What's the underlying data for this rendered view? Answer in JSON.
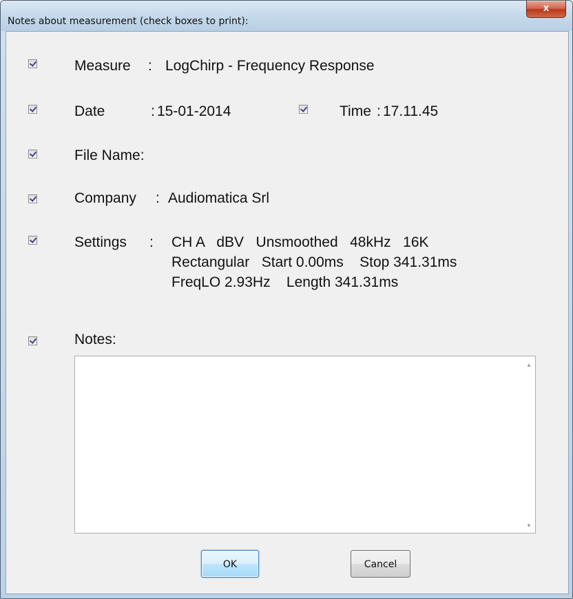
{
  "window": {
    "title": "Notes about measurement (check boxes to print):",
    "close_label": "x"
  },
  "fields": {
    "measure": {
      "label": "Measure",
      "sep": ":",
      "value": "LogChirp - Frequency Response",
      "checked": true
    },
    "date": {
      "label": "Date",
      "sep": ":",
      "value": "15-01-2014",
      "checked": true
    },
    "time": {
      "label": "Time",
      "sep": ":",
      "value": "17.11.45",
      "checked": true
    },
    "file_name": {
      "label": "File Name:",
      "value": "",
      "checked": true
    },
    "company": {
      "label": "Company",
      "sep": ":",
      "value": "Audiomatica Srl",
      "checked": true
    },
    "settings": {
      "label": "Settings",
      "sep": ":",
      "line1": "CH A   dBV   Unsmoothed   48kHz   16K",
      "line2": "Rectangular   Start 0.00ms    Stop 341.31ms",
      "line3": "FreqLO 2.93Hz    Length 341.31ms",
      "checked": true
    },
    "notes": {
      "label": "Notes:",
      "value": "",
      "checked": true
    }
  },
  "buttons": {
    "ok_label": "OK",
    "cancel_label": "Cancel"
  }
}
